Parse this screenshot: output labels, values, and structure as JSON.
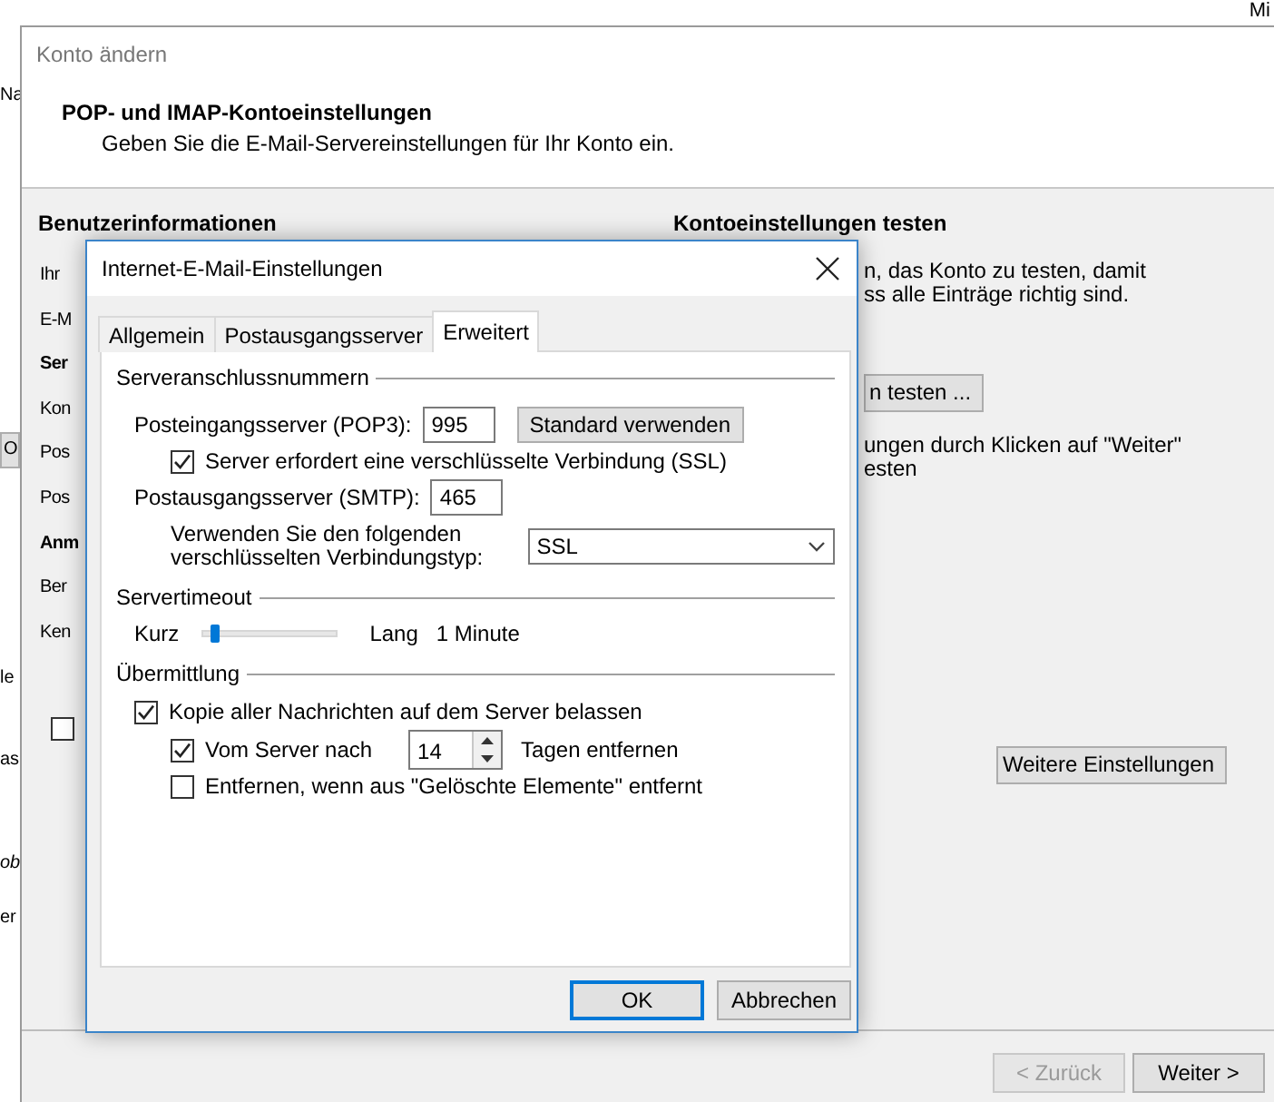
{
  "background_app": {
    "top_right": "Mi",
    "left_fragments": [
      {
        "text": "Na",
        "kind": "plain"
      },
      {
        "text": "O",
        "kind": "button"
      },
      {
        "text": "le",
        "kind": "plain"
      },
      {
        "text": "as",
        "kind": "plain"
      },
      {
        "text": "ob",
        "kind": "italic"
      },
      {
        "text": "er",
        "kind": "plain"
      }
    ]
  },
  "window": {
    "title": "Konto ändern",
    "heading": "POP- und IMAP-Kontoeinstellungen",
    "subtitle": "Geben Sie die E-Mail-Servereinstellungen für Ihr Konto ein."
  },
  "left_section": {
    "heading": "Benutzerinformationen",
    "labels": [
      {
        "text": "Ihr",
        "bold": false
      },
      {
        "text": "E-M",
        "bold": false
      },
      {
        "text": "Ser",
        "bold": true
      },
      {
        "text": "Kon",
        "bold": false
      },
      {
        "text": "Pos",
        "bold": false
      },
      {
        "text": "Pos",
        "bold": false
      },
      {
        "text": "Anm",
        "bold": true
      },
      {
        "text": "Ber",
        "bold": false
      },
      {
        "text": "Ken",
        "bold": false
      }
    ],
    "checkbox_checked": false
  },
  "right_section": {
    "heading": "Kontoeinstellungen testen",
    "intro_lines": [
      "n, das Konto zu testen, damit",
      "ss alle Einträge richtig sind."
    ],
    "test_button": "n testen ...",
    "next_lines": [
      "ungen durch Klicken auf \"Weiter\"",
      "esten"
    ],
    "more_button": "Weitere Einstellungen"
  },
  "footer_buttons": [
    {
      "label": "< Zurück",
      "disabled": true
    },
    {
      "label": "Weiter >",
      "disabled": false
    }
  ],
  "dialog": {
    "title": "Internet-E-Mail-Einstellungen",
    "tabs": [
      {
        "label": "Allgemein",
        "selected": false
      },
      {
        "label": "Postausgangsserver",
        "selected": false
      },
      {
        "label": "Erweitert",
        "selected": true
      }
    ],
    "ports": {
      "heading": "Serveranschlussnummern",
      "incoming_label": "Posteingangsserver (POP3):",
      "incoming_value": "995",
      "default_button": "Standard verwenden",
      "ssl_checkbox": {
        "label": "Server erfordert eine verschlüsselte Verbindung (SSL)",
        "checked": true
      },
      "outgoing_label": "Postausgangsserver (SMTP):",
      "outgoing_value": "465",
      "encryption_label": "Verwenden Sie den folgenden verschlüsselten Verbindungstyp:",
      "encryption_value": "SSL"
    },
    "timeout": {
      "heading": "Servertimeout",
      "min_label": "Kurz",
      "max_label": "Lang",
      "level": 0.08,
      "reading": "1 Minute"
    },
    "delivery": {
      "heading": "Übermittlung",
      "options": [
        {
          "label": "Kopie aller Nachrichten auf dem Server belassen",
          "checked": true,
          "children": [
            {
              "kind": "days",
              "label": "Vom Server nach",
              "checked": true,
              "days": "14",
              "suffix": "Tagen entfernen"
            },
            {
              "kind": "checkbox",
              "label": "Entfernen, wenn aus \"Gelöschte Elemente\" entfernt",
              "checked": false
            }
          ]
        }
      ]
    },
    "buttons": [
      {
        "label": "OK",
        "default": true
      },
      {
        "label": "Abbrechen",
        "default": false
      }
    ]
  }
}
